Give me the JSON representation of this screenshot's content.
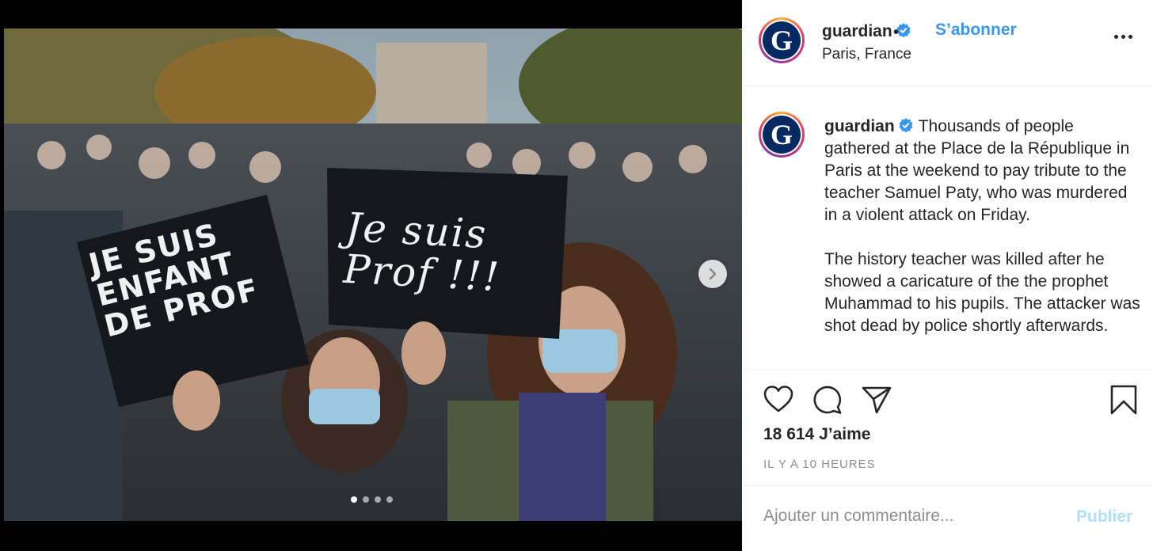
{
  "post": {
    "username": "guardian",
    "follow_separator": "•",
    "follow_label": "S’abonner",
    "location": "Paris, France",
    "avatar_letter": "G",
    "caption_paragraph_1": "Thousands of people gathered at the Place de la République in Paris at the weekend to pay tribute to the teacher Samuel Paty, who was murdered in a violent attack on Friday.",
    "caption_paragraph_2": "The history teacher was killed after he showed a caricature of the the prophet Muhammad to his pupils. The attacker was shot dead by police shortly afterwards.",
    "likes": "18 614 J’aime",
    "time_ago": "IL Y A 10 HEURES",
    "comment_placeholder": "Ajouter un commentaire...",
    "publish_label": "Publier"
  },
  "photo": {
    "sign_left_text": "JE SUIS\nENFANT\nDE PROF",
    "sign_right_text": "Je suis\nProf !!!",
    "carousel_count": 4,
    "carousel_active_index": 0
  },
  "icons": {
    "verified": "verified-badge-icon",
    "more": "more-options-icon",
    "like": "heart-icon",
    "comment": "comment-bubble-icon",
    "share": "paper-plane-icon",
    "save": "bookmark-icon",
    "next": "chevron-right-icon"
  },
  "colors": {
    "accent_blue": "#3897f0",
    "verified_blue": "#3897f0",
    "publish_disabled": "#b2dffc",
    "muted_text": "#8e8e8e",
    "guardian_navy": "#052962"
  }
}
